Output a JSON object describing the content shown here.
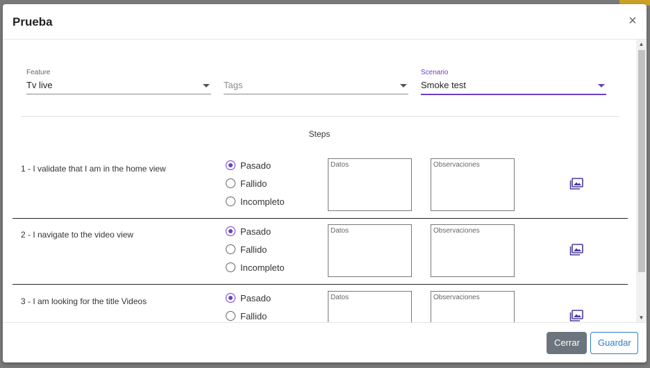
{
  "dialog": {
    "title": "Prueba",
    "close_symbol": "×"
  },
  "filters": {
    "feature": {
      "label": "Feature",
      "value": "Tv live"
    },
    "tags": {
      "placeholder": "Tags"
    },
    "scenario": {
      "label": "Scenario",
      "value": "Smoke test"
    }
  },
  "steps_title": "Steps",
  "steps": [
    {
      "label": "1 - I validate that I am in the home view",
      "options": [
        "Pasado",
        "Fallido",
        "Incompleto"
      ],
      "selected": "Pasado",
      "datos_placeholder": "Datos",
      "observaciones_placeholder": "Observaciones"
    },
    {
      "label": "2 - I navigate to the video view",
      "options": [
        "Pasado",
        "Fallido",
        "Incompleto"
      ],
      "selected": "Pasado",
      "datos_placeholder": "Datos",
      "observaciones_placeholder": "Observaciones"
    },
    {
      "label": "3 - I am looking for the title Videos",
      "options": [
        "Pasado",
        "Fallido"
      ],
      "selected": "Pasado",
      "datos_placeholder": "Datos",
      "observaciones_placeholder": "Observaciones"
    }
  ],
  "footer": {
    "close_label": "Cerrar",
    "save_label": "Guardar"
  },
  "colors": {
    "accent": "#6a3fc9",
    "close_button": "#6c757d",
    "save_button": "#2a7ec8"
  },
  "icons": {
    "step_image": "image-gallery-icon",
    "close": "close-icon"
  }
}
